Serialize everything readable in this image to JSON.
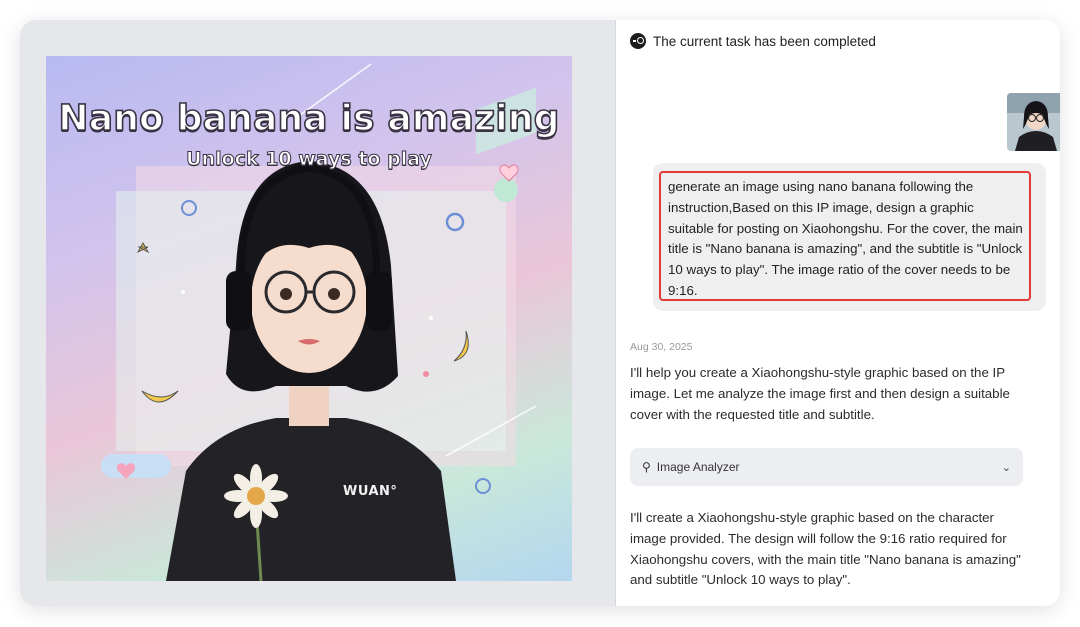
{
  "status": {
    "text": "The current task has been completed",
    "icon": "task-done-icon"
  },
  "artwork": {
    "title": "Nano banana is amazing",
    "subtitle": "Unlock 10 ways to play",
    "shirt_brand": "WUAN°"
  },
  "chat": {
    "user_message": "generate an image using nano banana following the instruction,Based on this IP image, design a graphic suitable for posting on Xiaohongshu. For the cover, the main title is \"Nano banana is amazing\", and the subtitle is \"Unlock 10 ways to play\". The image ratio of the cover needs to be 9:16.",
    "timestamp": "Aug 30, 2025",
    "assistant_intro": "I'll help you create a Xiaohongshu-style graphic based on the IP image. Let me analyze the image first and then design a suitable cover with the requested title and subtitle.",
    "tool_label": "Image Analyzer",
    "assistant_followup": "I'll create a Xiaohongshu-style graphic based on the character image provided. The design will follow the 9:16 ratio required for Xiaohongshu covers, with the main title \"Nano banana is amazing\" and subtitle \"Unlock 10 ways to play\"."
  },
  "colors": {
    "highlight_border": "#e53935",
    "bubble_bg": "#efefef",
    "tool_bg": "#eceef1"
  }
}
